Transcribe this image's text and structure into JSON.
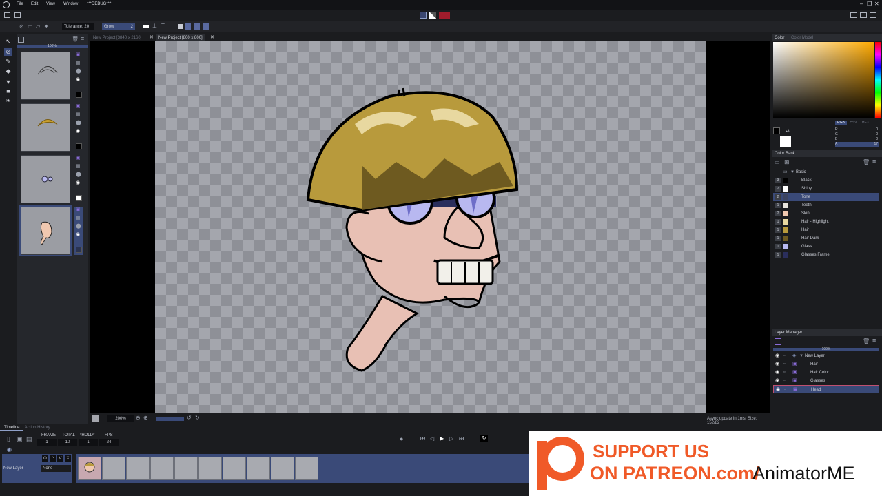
{
  "menu": {
    "items": [
      "File",
      "Edit",
      "View",
      "Window",
      "***DEBUG***"
    ]
  },
  "options": {
    "tolerance_label": "Tolerance:",
    "tolerance_value": "20",
    "grow_label": "Grow",
    "grow_value": "2"
  },
  "tabs": [
    {
      "label": "New Project [3840 x 2160]"
    },
    {
      "label": "New Project [800 x 800]"
    }
  ],
  "layers_panel": {
    "opacity": "100%"
  },
  "canvas_bar": {
    "zoom": "200%",
    "status": "Async update in 1ms. Size: 152/82"
  },
  "color": {
    "tab1": "Color",
    "tab2": "Color Model",
    "modes": [
      "RGB",
      "HSV",
      "HEX"
    ],
    "channels": [
      "R",
      "G",
      "B",
      "A"
    ],
    "values": [
      "0",
      "0",
      "0",
      "17"
    ]
  },
  "color_bank": {
    "title": "Color Bank",
    "group": "Basic",
    "items": [
      {
        "num": "3",
        "name": "Black",
        "color": "#000000"
      },
      {
        "num": "2",
        "name": "Shiny",
        "color": "#ffffff"
      },
      {
        "num": "2",
        "name": "Tone",
        "color": "#3c4460"
      },
      {
        "num": "1",
        "name": "Teeth",
        "color": "#e8e4dc"
      },
      {
        "num": "2",
        "name": "Skin",
        "color": "#f0c8b0"
      },
      {
        "num": "1",
        "name": "Hair - Highlight",
        "color": "#e8d8a0"
      },
      {
        "num": "1",
        "name": "Hair",
        "color": "#b89a3c"
      },
      {
        "num": "1",
        "name": "Hair Dark",
        "color": "#6e5a20"
      },
      {
        "num": "1",
        "name": "Glass",
        "color": "#b8b8f0"
      },
      {
        "num": "1",
        "name": "Glasses Frame",
        "color": "#2a2e5c"
      }
    ]
  },
  "layer_manager": {
    "title": "Layer Manager",
    "opacity": "100%",
    "layers": [
      {
        "name": "New Layer"
      },
      {
        "name": "Hair"
      },
      {
        "name": "Hair Color"
      },
      {
        "name": "Glasses"
      },
      {
        "name": "Head"
      }
    ]
  },
  "timeline": {
    "tab1": "Timeline",
    "tab2": "Action History",
    "headers": [
      "FRAME",
      "TOTAL",
      "*HOLD*",
      "FPS"
    ],
    "values": [
      "1",
      "10",
      "1",
      "24"
    ],
    "layer_name": "New Layer",
    "blend": "None",
    "ctrl": [
      "O",
      "^",
      "V",
      "X"
    ]
  },
  "patreon": {
    "line1": "SUPPORT US",
    "line2a": "ON PATREON.com/",
    "line2b": "AnimatorME",
    "color": "#f05a28"
  }
}
